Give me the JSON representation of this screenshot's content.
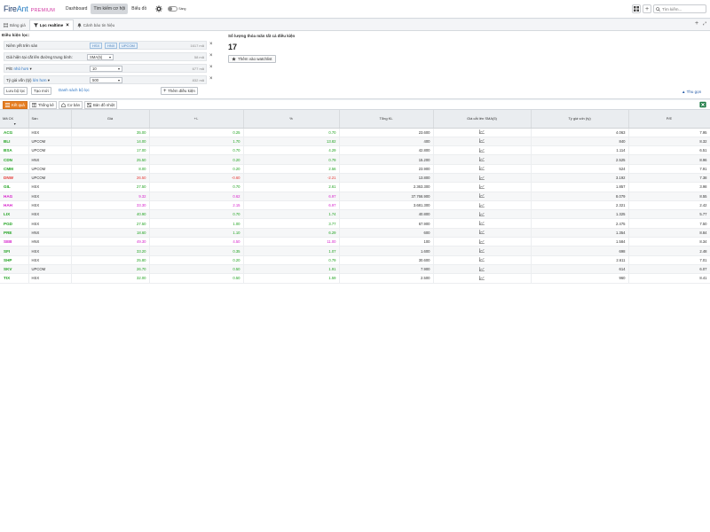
{
  "app": {
    "logo_fire": "Fire",
    "logo_ant": "Ant",
    "logo_premium": "PREMIUM"
  },
  "nav": {
    "items": [
      "Dashboard",
      "Tìm kiếm cơ hội",
      "Biểu đồ"
    ],
    "active_index": 1,
    "toggle_label": "Sáng"
  },
  "search": {
    "placeholder": "Tìm kiếm..."
  },
  "tabs": [
    {
      "label": "Bảng giá",
      "icon": "grid-icon"
    },
    {
      "label": "Lọc realtime",
      "icon": "filter-icon",
      "active": true
    },
    {
      "label": "Cảnh báo tin hiệu",
      "icon": "bell-icon"
    }
  ],
  "conditions": {
    "title": "Điều kiện lọc:",
    "rows": [
      {
        "label": "Niêm yết trên sàn",
        "exchanges": [
          "HSX",
          "HNX",
          "UPCOM"
        ],
        "count": "1617 mã"
      },
      {
        "label": "Giá hiện tại cắt lên đường trung bình:",
        "select": "SMA(5)",
        "count": "58 mã"
      },
      {
        "label_prefix": "P/E",
        "operator": "nhỏ hơn",
        "value": "10",
        "count": "677 mã"
      },
      {
        "label_prefix": "Tỷ giá vốn (tỷ)",
        "operator": "lớn hơn",
        "value": "500",
        "count": "832 mã"
      }
    ],
    "save_label": "Lưu bộ lọc",
    "new_label": "Tạo mới",
    "list_label": "Danh sách bộ lọc",
    "add_label": "Thêm điều kiện"
  },
  "result": {
    "title": "Số lượng thỏa mãn tất cả điều kiện",
    "count": "17",
    "watchlist_label": "Thêm vào watchlist",
    "collapse_label": "Thu gọn"
  },
  "result_tabs": [
    {
      "label": "Kết quả",
      "icon": "list-icon",
      "active": true
    },
    {
      "label": "Thống kê",
      "icon": "table-icon"
    },
    {
      "label": "Cơ bản",
      "icon": "home-icon"
    },
    {
      "label": "Bản đồ nhiệt",
      "icon": "map-icon"
    }
  ],
  "table": {
    "headers": [
      "Mã CK",
      "Sàn",
      "Giá",
      "+/-",
      "%",
      "Tổng KL",
      "Giá cắt lên SMA(5)",
      "Tỷ giá vốn (tỷ)",
      "P/E"
    ],
    "rows": [
      {
        "symbol": "ACG",
        "exchange": "HSX",
        "price": "35.00",
        "change": "0.25",
        "pct": "0.70",
        "volume": "23.600",
        "cap": "4.063",
        "pe": "7.95",
        "color": "up"
      },
      {
        "symbol": "BLI",
        "exchange": "UPCOM",
        "price": "14.00",
        "change": "1.70",
        "pct": "13.82",
        "volume": "400",
        "cap": "840",
        "pe": "8.32",
        "color": "up"
      },
      {
        "symbol": "BSA",
        "exchange": "UPCOM",
        "price": "17.00",
        "change": "0.70",
        "pct": "4.29",
        "volume": "42.800",
        "cap": "1.114",
        "pe": "6.51",
        "color": "up"
      },
      {
        "symbol": "CDN",
        "exchange": "HNX",
        "price": "25.50",
        "change": "0.20",
        "pct": "0.79",
        "volume": "15.200",
        "cap": "2.525",
        "pe": "8.96",
        "color": "up"
      },
      {
        "symbol": "CMM",
        "exchange": "UPCOM",
        "price": "8.00",
        "change": "0.20",
        "pct": "2.56",
        "volume": "23.900",
        "cap": "524",
        "pe": "7.91",
        "color": "up"
      },
      {
        "symbol": "DNW",
        "exchange": "UPCOM",
        "price": "26.50",
        "change": "-0.60",
        "pct": "-2.21",
        "volume": "13.800",
        "cap": "3.192",
        "pe": "7.38",
        "color": "down"
      },
      {
        "symbol": "GIL",
        "exchange": "HSX",
        "price": "27.50",
        "change": "0.70",
        "pct": "2.61",
        "volume": "2.363.300",
        "cap": "1.857",
        "pe": "3.98",
        "color": "up"
      },
      {
        "symbol": "HAG",
        "exchange": "HSX",
        "price": "9.32",
        "change": "0.62",
        "pct": "6.97",
        "volume": "37.766.900",
        "cap": "8.079",
        "pe": "8.55",
        "color": "ceil"
      },
      {
        "symbol": "HAH",
        "exchange": "HSX",
        "price": "33.30",
        "change": "2.15",
        "pct": "6.97",
        "volume": "3.681.300",
        "cap": "2.321",
        "pe": "2.42",
        "color": "ceil"
      },
      {
        "symbol": "LIX",
        "exchange": "HSX",
        "price": "40.90",
        "change": "0.70",
        "pct": "1.74",
        "volume": "40.800",
        "cap": "1.325",
        "pe": "5.77",
        "color": "up"
      },
      {
        "symbol": "PGD",
        "exchange": "HSX",
        "price": "27.50",
        "change": "1.00",
        "pct": "3.77",
        "volume": "67.900",
        "cap": "2.475",
        "pe": "7.50",
        "color": "up"
      },
      {
        "symbol": "PRE",
        "exchange": "HNX",
        "price": "18.60",
        "change": "1.10",
        "pct": "6.29",
        "volume": "600",
        "cap": "1.354",
        "pe": "8.84",
        "color": "up"
      },
      {
        "symbol": "SEB",
        "exchange": "HNX",
        "price": "49.30",
        "change": "4.50",
        "pct": "11.00",
        "volume": "100",
        "cap": "1.584",
        "pe": "8.34",
        "color": "ceil"
      },
      {
        "symbol": "SFI",
        "exchange": "HSX",
        "price": "33.20",
        "change": "0.35",
        "pct": "1.07",
        "volume": "1.600",
        "cap": "698",
        "pe": "2.48",
        "color": "up"
      },
      {
        "symbol": "SHP",
        "exchange": "HSX",
        "price": "25.80",
        "change": "0.20",
        "pct": "0.79",
        "volume": "30.600",
        "cap": "2.611",
        "pe": "7.01",
        "color": "up"
      },
      {
        "symbol": "SKV",
        "exchange": "UPCOM",
        "price": "26.70",
        "change": "0.50",
        "pct": "1.91",
        "volume": "7.900",
        "cap": "614",
        "pe": "6.07",
        "color": "up"
      },
      {
        "symbol": "TIX",
        "exchange": "HSX",
        "price": "32.00",
        "change": "0.50",
        "pct": "1.59",
        "volume": "2.500",
        "cap": "960",
        "pe": "8.41",
        "color": "up"
      }
    ]
  },
  "colors": {
    "up": "#22a322",
    "down": "#e53935",
    "ceil": "#d61fcb",
    "accent": "#e67e22"
  }
}
